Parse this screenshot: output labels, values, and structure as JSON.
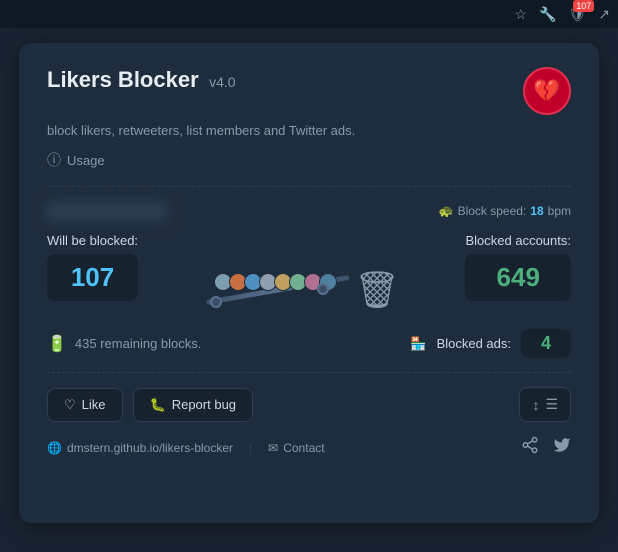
{
  "topbar": {
    "badge_count": "107"
  },
  "card": {
    "title": "Likers Blocker",
    "version": "v4.0",
    "subtitle": "block likers, retweeters, list members and Twitter ads.",
    "usage_label": "Usage",
    "block_speed_label": "Block speed:",
    "block_speed_value": "18",
    "block_speed_unit": "bpm",
    "will_be_blocked_label": "Will be blocked:",
    "will_be_blocked_count": "107",
    "blocked_accounts_label": "Blocked accounts:",
    "blocked_accounts_count": "649",
    "remaining_blocks": "435 remaining blocks.",
    "blocked_ads_label": "Blocked ads:",
    "blocked_ads_count": "4",
    "like_button": "Like",
    "report_bug_button": "Report bug",
    "footer_link": "dmstern.github.io/likers-blocker",
    "contact_label": "Contact"
  }
}
